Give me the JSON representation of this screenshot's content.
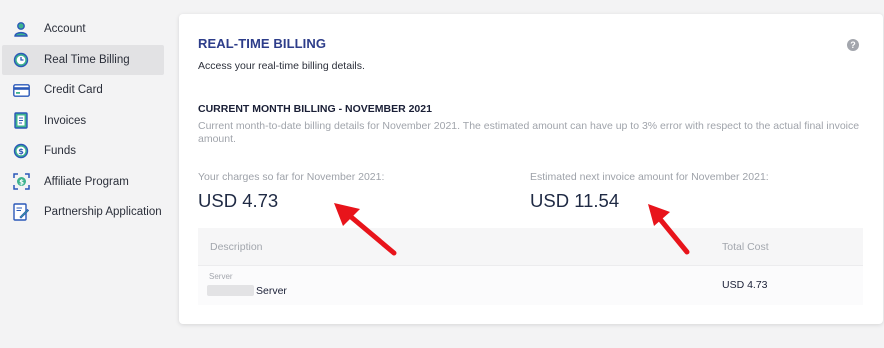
{
  "sidebar": {
    "items": [
      {
        "label": "Account",
        "icon": "user-icon",
        "active": false
      },
      {
        "label": "Real Time Billing",
        "icon": "clock-icon",
        "active": true
      },
      {
        "label": "Credit Card",
        "icon": "credit-card-icon",
        "active": false
      },
      {
        "label": "Invoices",
        "icon": "invoice-icon",
        "active": false
      },
      {
        "label": "Funds",
        "icon": "dollar-icon",
        "active": false
      },
      {
        "label": "Affiliate Program",
        "icon": "affiliate-icon",
        "active": false
      },
      {
        "label": "Partnership Application",
        "icon": "partnership-icon",
        "active": false
      }
    ]
  },
  "main": {
    "title": "REAL-TIME BILLING",
    "subtitle": "Access your real-time billing details.",
    "help_icon": "?",
    "section_title": "CURRENT MONTH BILLING - NOVEMBER 2021",
    "section_desc": "Current month-to-date billing details for November 2021. The estimated amount can have up to 3% error with respect to the actual final invoice amount.",
    "charges_label": "Your charges so far for November 2021:",
    "charges_value": "USD 4.73",
    "estimate_label": "Estimated next invoice amount for November 2021:",
    "estimate_value": "USD 11.54",
    "table": {
      "headers": {
        "description": "Description",
        "total_cost": "Total Cost"
      },
      "rows": [
        {
          "type": "Server",
          "name": "Server",
          "cost": "USD 4.73"
        }
      ]
    }
  },
  "colors": {
    "accent": "#2d3d8a",
    "icon_blue": "#2a58b8",
    "icon_green": "#3db38e",
    "annotation_red": "#e8141b"
  }
}
